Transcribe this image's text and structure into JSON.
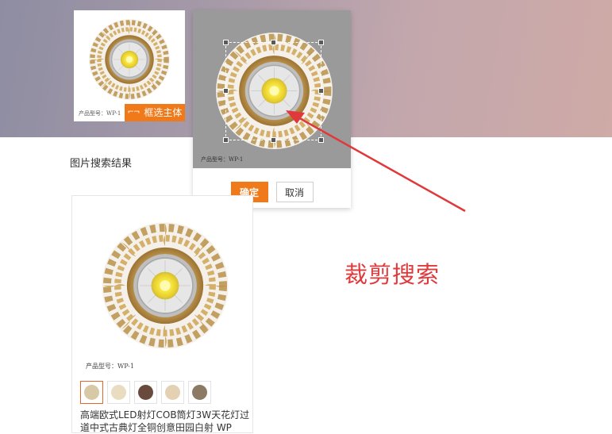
{
  "thumbnail": {
    "caption": "产品型号：WP-1",
    "select_button_icon": "crop-icon",
    "select_button_label": "框选主体"
  },
  "crop_panel": {
    "stage_caption": "产品型号：WP-1",
    "confirm_label": "确定",
    "cancel_label": "取消"
  },
  "results": {
    "heading": "图片搜索结果",
    "card": {
      "caption": "产品型号：WP-1",
      "title": "高端欧式LED射灯COB筒灯3W天花灯过道中式古典灯全铜创意田园白射 WP"
    },
    "swatches": [
      {
        "color": "#d8c9a6"
      },
      {
        "color": "#e9dcc0"
      },
      {
        "color": "#6b4a3e"
      },
      {
        "color": "#e4d1b3"
      },
      {
        "color": "#8c7a62"
      }
    ]
  },
  "annotation": {
    "text": "裁剪搜索",
    "color": "#e0393c"
  },
  "colors": {
    "accent": "#f07a1a"
  }
}
